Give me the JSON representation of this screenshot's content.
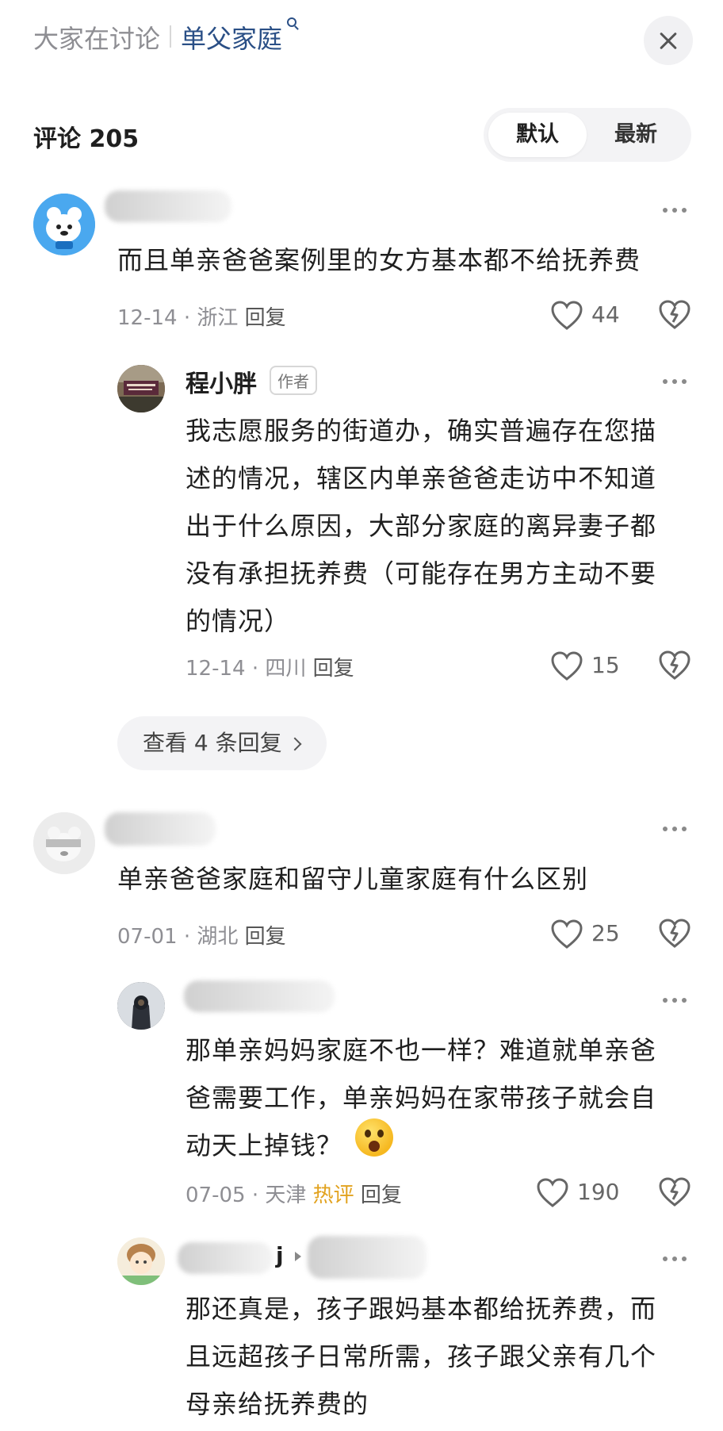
{
  "header": {
    "topic_prefix": "大家在讨论",
    "topic_name": "单父家庭"
  },
  "comments_header": {
    "count_label": "评论 205",
    "sort_default": "默认",
    "sort_latest": "最新"
  },
  "comments": [
    {
      "text": "而且单亲爸爸案例里的女方基本都不给抚养费",
      "meta": "12-14 · 浙江",
      "reply": "回复",
      "likes": "44"
    },
    {
      "username": "程小胖",
      "badge": "作者",
      "text_lines": [
        "我志愿服务的街道办，确实普遍存在您描",
        "述的情况，辖区内单亲爸爸走访中不知道",
        "出于什么原因，大部分家庭的离异妻子都",
        "没有承担抚养费（可能存在男方主动不要",
        "的情况）"
      ],
      "meta": "12-14 · 四川",
      "reply": "回复",
      "likes": "15"
    },
    {
      "text": "单亲爸爸家庭和留守儿童家庭有什么区别",
      "meta": "07-01 · 湖北",
      "reply": "回复",
      "likes": "25"
    },
    {
      "text_lines": [
        "那单亲妈妈家庭不也一样？难道就单亲爸",
        "爸需要工作，单亲妈妈在家带孩子就会自",
        "动天上掉钱？"
      ],
      "meta": "07-05 · 天津",
      "hot": "热评",
      "reply": "回复",
      "likes": "190"
    },
    {
      "name_tail": "j",
      "text_lines": [
        "那还真是，孩子跟妈基本都给抚养费，而",
        "且远超孩子日常所需，孩子跟父亲有几个",
        "母亲给抚养费的"
      ]
    }
  ],
  "view_replies": "查看 4 条回复",
  "icons": [
    "close-icon",
    "search-icon",
    "more-icon",
    "heart-icon",
    "dislike-icon",
    "chevron-right-icon",
    "reply-arrow-icon",
    "shocked-emoji-icon"
  ],
  "colors": {
    "topic_accent": "#2a4f86",
    "hot_label": "#e2a21e",
    "muted_text": "#8e8e93"
  }
}
